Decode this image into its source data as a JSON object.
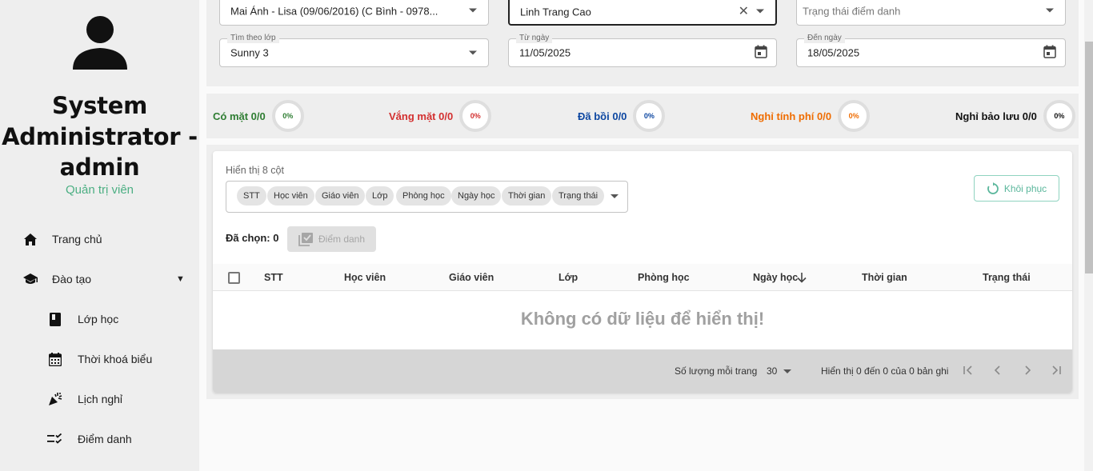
{
  "sidebar": {
    "user_name": "System Administrator - admin",
    "user_role": "Quản trị viên",
    "items": [
      {
        "label": "Trang chủ",
        "icon": "home-icon"
      },
      {
        "label": "Đào tạo",
        "icon": "graduation-cap-icon",
        "expanded": true
      },
      {
        "label": "Lớp học",
        "icon": "book-icon"
      },
      {
        "label": "Thời khoá biểu",
        "icon": "calendar-icon"
      },
      {
        "label": "Lịch nghỉ",
        "icon": "party-popper-icon"
      },
      {
        "label": "Điểm danh",
        "icon": "checklist-icon"
      }
    ]
  },
  "filters": {
    "student": {
      "value": "Mai Ánh - Lisa (09/06/2016) (C Bình - 0978..."
    },
    "teacher": {
      "value": "Linh  Trang Cao"
    },
    "status": {
      "placeholder": "Trạng thái điểm danh"
    },
    "class": {
      "label": "Tìm theo lớp",
      "value": "Sunny 3"
    },
    "from_date": {
      "label": "Từ ngày",
      "value": "11/05/2025"
    },
    "to_date": {
      "label": "Đến ngày",
      "value": "18/05/2025"
    }
  },
  "stats": [
    {
      "label": "Có mặt 0/0",
      "percent": "0%",
      "color": "#2e7d32"
    },
    {
      "label": "Vắng mặt 0/0",
      "percent": "0%",
      "color": "#d32f2f"
    },
    {
      "label": "Đã bồi 0/0",
      "percent": "0%",
      "color": "#0d47a1"
    },
    {
      "label": "Nghỉ tính phí 0/0",
      "percent": "0%",
      "color": "#ef6c00"
    },
    {
      "label": "Nghỉ bảo lưu 0/0",
      "percent": "0%",
      "color": "#111111"
    }
  ],
  "columns_control": {
    "label": "Hiển thị 8 cột",
    "chips": [
      "STT",
      "Học viên",
      "Giáo viên",
      "Lớp",
      "Phòng học",
      "Ngày học",
      "Thời gian",
      "Trạng thái"
    ],
    "restore_label": "Khôi phục"
  },
  "selection": {
    "selected_label": "Đã chọn: 0",
    "attend_label": "Điểm danh"
  },
  "table": {
    "headers": [
      "STT",
      "Học viên",
      "Giáo viên",
      "Lớp",
      "Phòng học",
      "Ngày học",
      "Thời gian",
      "Trạng thái"
    ],
    "empty_message": "Không có dữ liệu để hiển thị!"
  },
  "pagination": {
    "rows_per_page_label": "Số lượng mỗi trang",
    "rows_per_page": "30",
    "range_text": "Hiển thị 0 đến 0 của 0 bản ghi"
  }
}
